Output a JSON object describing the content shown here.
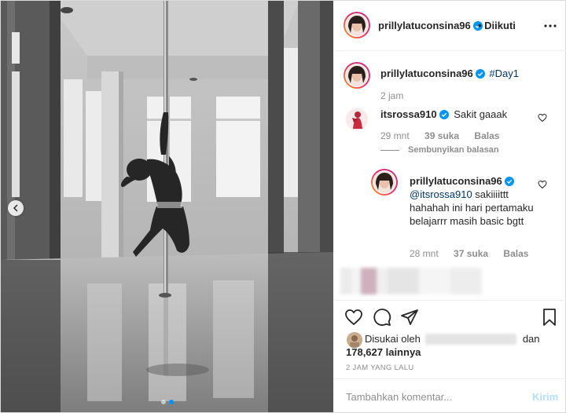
{
  "post": {
    "username": "prillylatuconsina96",
    "follow_status": "• Diikuti",
    "more_icon": "more-horizontal-icon",
    "carousel": {
      "total": 2,
      "active": 2
    }
  },
  "caption": {
    "username": "prillylatuconsina96",
    "text": "#Day1",
    "time": "2 jam"
  },
  "comments": [
    {
      "username": "itsrossa910",
      "text": "Sakit gaaak",
      "time": "29 mnt",
      "likes": "39 suka",
      "reply": "Balas",
      "toggle_replies": "Sembunyikan balasan",
      "replies": [
        {
          "username": "prillylatuconsina96",
          "mention": "@itsrossa910",
          "text": " sakiiiittt hahahah ini hari pertamaku belajarrr masih basic bgtt",
          "time": "28 mnt",
          "likes": "37 suka",
          "reply": "Balas"
        }
      ]
    }
  ],
  "likes": {
    "prefix": "Disukai oleh",
    "conjunction": "dan",
    "count": "178,627 lainnya"
  },
  "timestamp": "2 JAM YANG LALU",
  "comment_box": {
    "placeholder": "Tambahkan komentar...",
    "post_label": "Kirim"
  },
  "colors": {
    "verified": "#0095f6",
    "link": "#00376b",
    "muted": "#8e8e8e",
    "post_disabled": "#b2dffc"
  }
}
